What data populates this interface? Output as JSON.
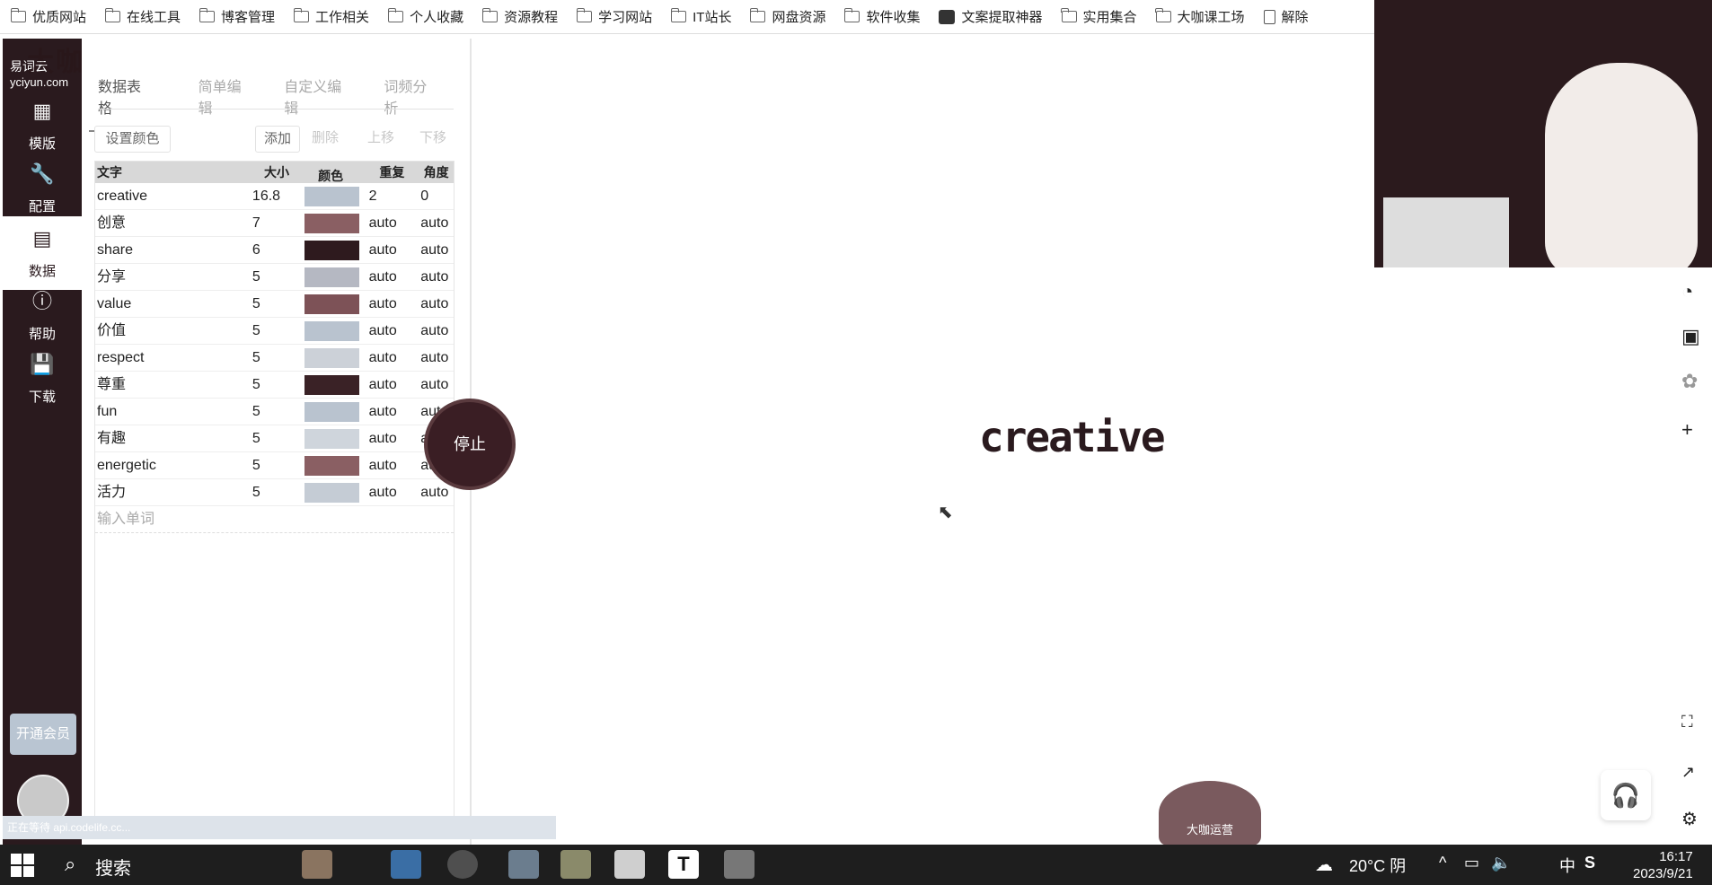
{
  "bookmarks": [
    {
      "label": "优质网站",
      "icon": "folder-icon"
    },
    {
      "label": "在线工具",
      "icon": "folder-icon"
    },
    {
      "label": "博客管理",
      "icon": "folder-icon"
    },
    {
      "label": "工作相关",
      "icon": "folder-icon"
    },
    {
      "label": "个人收藏",
      "icon": "folder-icon"
    },
    {
      "label": "资源教程",
      "icon": "folder-icon"
    },
    {
      "label": "学习网站",
      "icon": "folder-icon"
    },
    {
      "label": "IT站长",
      "icon": "folder-icon"
    },
    {
      "label": "网盘资源",
      "icon": "folder-icon"
    },
    {
      "label": "软件收集",
      "icon": "folder-icon"
    },
    {
      "label": "文案提取神器",
      "icon": "app-icon"
    },
    {
      "label": "实用集合",
      "icon": "folder-icon"
    },
    {
      "label": "大咖课工场",
      "icon": "folder-icon"
    },
    {
      "label": "解除",
      "icon": "document-icon"
    }
  ],
  "logo": {
    "name": "易词云",
    "domain": "yciyun.com"
  },
  "watermark": "大咖",
  "sidebar": {
    "items": [
      {
        "label": "模版",
        "icon": "template-icon"
      },
      {
        "label": "配置",
        "icon": "wrench-icon"
      },
      {
        "label": "数据",
        "icon": "inbox-icon",
        "active": true
      },
      {
        "label": "帮助",
        "icon": "help-icon"
      },
      {
        "label": "下载",
        "icon": "save-icon"
      }
    ],
    "vip": "开通会员"
  },
  "tabs": [
    "数据表格",
    "简单编辑",
    "自定义编辑",
    "词频分析"
  ],
  "toolbar": {
    "set_color": "设置颜色",
    "add": "添加",
    "delete": "删除",
    "up": "上移",
    "down": "下移"
  },
  "table": {
    "headers": [
      "文字",
      "大小",
      "颜色",
      "重复",
      "角度"
    ],
    "rows": [
      {
        "word": "creative",
        "size": "16.8",
        "color": "#b9c3cf",
        "repeat": "2",
        "angle": "0"
      },
      {
        "word": "创意",
        "size": "7",
        "color": "#8a5f63",
        "repeat": "auto",
        "angle": "auto"
      },
      {
        "word": "share",
        "size": "6",
        "color": "#2e1a1e",
        "repeat": "auto",
        "angle": "auto"
      },
      {
        "word": "分享",
        "size": "5",
        "color": "#b5b8c2",
        "repeat": "auto",
        "angle": "auto"
      },
      {
        "word": "value",
        "size": "5",
        "color": "#7d5257",
        "repeat": "auto",
        "angle": "auto"
      },
      {
        "word": "价值",
        "size": "5",
        "color": "#b9c3cf",
        "repeat": "auto",
        "angle": "auto"
      },
      {
        "word": "respect",
        "size": "5",
        "color": "#ccd1d8",
        "repeat": "auto",
        "angle": "auto"
      },
      {
        "word": "尊重",
        "size": "5",
        "color": "#3a2226",
        "repeat": "auto",
        "angle": "auto"
      },
      {
        "word": "fun",
        "size": "5",
        "color": "#b9c3cf",
        "repeat": "auto",
        "angle": "auto"
      },
      {
        "word": "有趣",
        "size": "5",
        "color": "#cfd5dc",
        "repeat": "auto",
        "angle": "auto"
      },
      {
        "word": "energetic",
        "size": "5",
        "color": "#8a5f63",
        "repeat": "auto",
        "angle": "auto"
      },
      {
        "word": "活力",
        "size": "5",
        "color": "#c5ccd5",
        "repeat": "auto",
        "angle": "auto"
      }
    ],
    "input_placeholder": "输入单词"
  },
  "stop_button": "停止",
  "status_text": "正在等待 api.codelife.cc...",
  "wordcloud_text": "creative",
  "mascot_text": "大咖运营",
  "taskbar": {
    "search": "搜索",
    "weather": "20°C 阴",
    "ime": "中",
    "time": "16:17",
    "date": "2023/9/21"
  }
}
